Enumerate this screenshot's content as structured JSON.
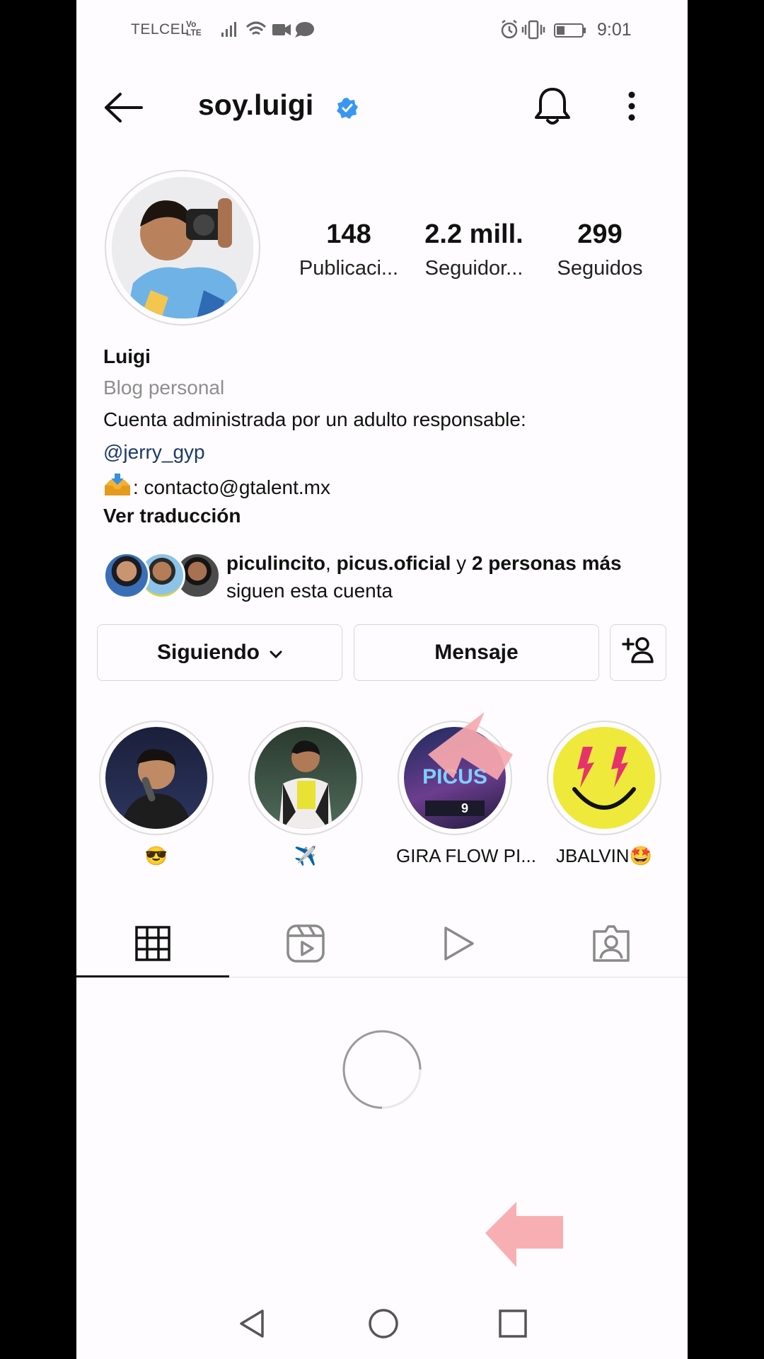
{
  "status_bar": {
    "carrier": "TELCEL",
    "lte_top": "Vo",
    "lte_bottom": "LTE",
    "time": "9:01"
  },
  "header": {
    "username": "soy.luigi",
    "icons": [
      "back-arrow-icon",
      "verified-badge-icon",
      "bell-icon",
      "more-options-icon"
    ]
  },
  "stats": [
    {
      "value": "148",
      "label": "Publicaci..."
    },
    {
      "value": "2.2 mill.",
      "label": "Seguidor..."
    },
    {
      "value": "299",
      "label": "Seguidos"
    }
  ],
  "bio": {
    "name": "Luigi",
    "category": "Blog personal",
    "line1": "Cuenta administrada por un adulto responsable:",
    "mention": "@jerry_gyp",
    "contact": ": contacto@gtalent.mx",
    "translate": "Ver traducción"
  },
  "followed_by": {
    "user1": "piculincito",
    "sep": ", ",
    "user2": "picus.oficial",
    "and": " y ",
    "count": "2 personas más",
    "suffix": " siguen esta cuenta"
  },
  "buttons": {
    "following": "Siguiendo",
    "message": "Mensaje"
  },
  "highlights": [
    {
      "label": "😎"
    },
    {
      "label": "✈️"
    },
    {
      "label": "GIRA FLOW PI..."
    },
    {
      "label": "JBALVIN🤩"
    }
  ],
  "highlight_image_text": {
    "title": "PICUS",
    "number": "9"
  },
  "tabs": [
    "grid-icon",
    "reels-icon",
    "video-icon",
    "tagged-icon"
  ],
  "colors": {
    "background": "#fefcfe",
    "verified": "#3897f0",
    "annotation_arrow": "#f7a8ae",
    "link": "#1c3a6a"
  }
}
